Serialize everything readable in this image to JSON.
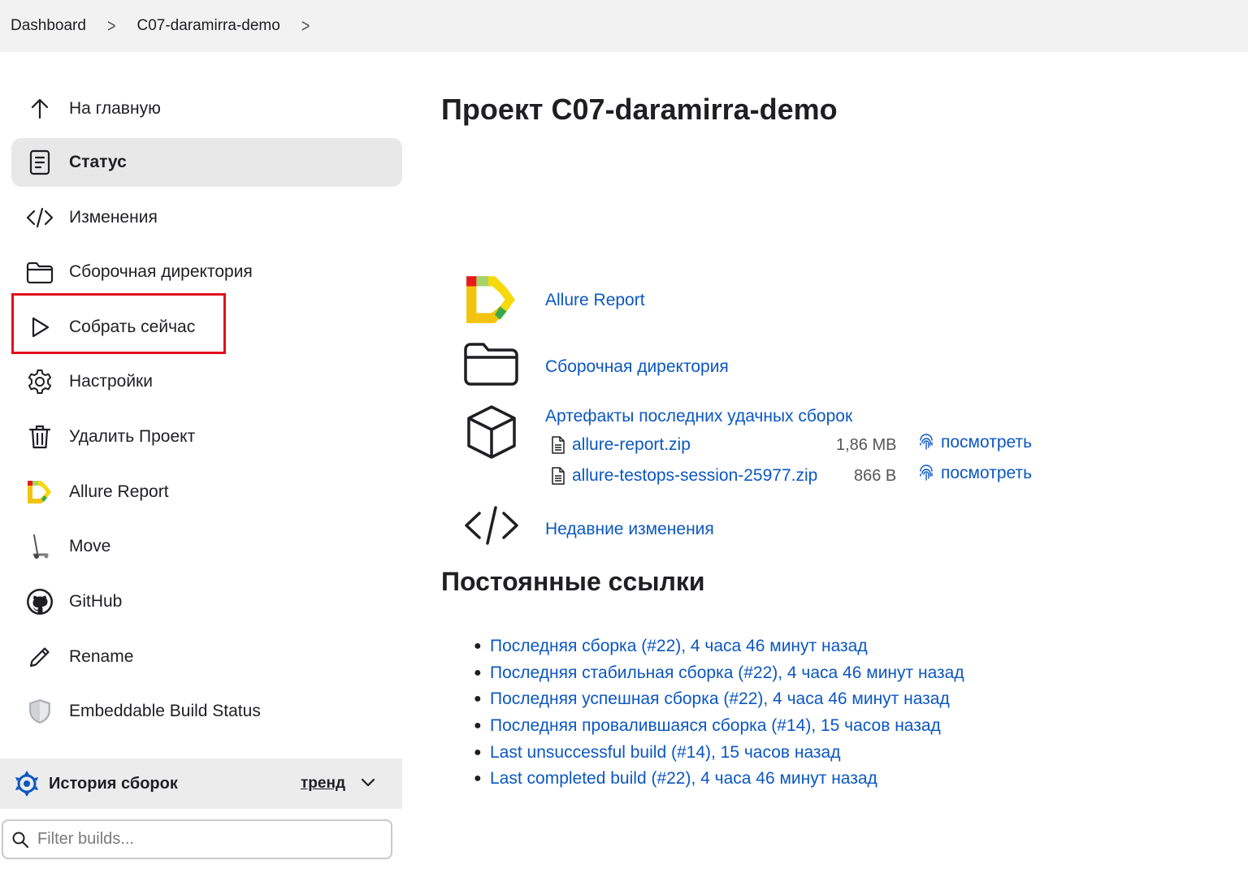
{
  "breadcrumb": {
    "items": [
      "Dashboard",
      "C07-daramirra-demo"
    ]
  },
  "sidebar": {
    "items": [
      {
        "label": "На главную",
        "icon": "arrow-up-icon"
      },
      {
        "label": "Статус",
        "icon": "document-icon",
        "active": true
      },
      {
        "label": "Изменения",
        "icon": "code-icon"
      },
      {
        "label": "Сборочная директория",
        "icon": "folder-icon"
      },
      {
        "label": "Собрать сейчас",
        "icon": "play-icon",
        "highlighted": true
      },
      {
        "label": "Настройки",
        "icon": "gear-icon"
      },
      {
        "label": "Удалить Проект",
        "icon": "trash-icon"
      },
      {
        "label": "Allure Report",
        "icon": "allure-logo-icon"
      },
      {
        "label": "Move",
        "icon": "move-icon"
      },
      {
        "label": "GitHub",
        "icon": "github-icon"
      },
      {
        "label": "Rename",
        "icon": "pencil-icon"
      },
      {
        "label": "Embeddable Build Status",
        "icon": "shield-icon"
      }
    ],
    "history": {
      "title": "История сборок",
      "trend_label": "тренд",
      "filter_placeholder": "Filter builds..."
    }
  },
  "main": {
    "title": "Проект C07-daramirra-demo",
    "links": {
      "allure": "Allure Report",
      "workspace": "Сборочная директория",
      "artifacts": "Артефакты последних удачных сборок",
      "changes": "Недавние изменения"
    },
    "artifacts": [
      {
        "name": "allure-report.zip",
        "size": "1,86 MB",
        "view": "посмотреть"
      },
      {
        "name": "allure-testops-session-25977.zip",
        "size": "866 B",
        "view": "посмотреть"
      }
    ],
    "permalinks_title": "Постоянные ссылки",
    "permalinks": [
      "Последняя сборка (#22), 4 часа 46 минут назад",
      "Последняя стабильная сборка (#22), 4 часа 46 минут назад",
      "Последняя успешная сборка (#22), 4 часа 46 минут назад",
      "Последняя провалившаяся сборка (#14), 15 часов назад",
      "Last unsuccessful build (#14), 15 часов назад",
      "Last completed build (#22), 4 часа 46 минут назад"
    ]
  },
  "colors": {
    "link": "#0b57c2",
    "active_bg": "#e8e8e8",
    "highlight": "#e0101c"
  }
}
